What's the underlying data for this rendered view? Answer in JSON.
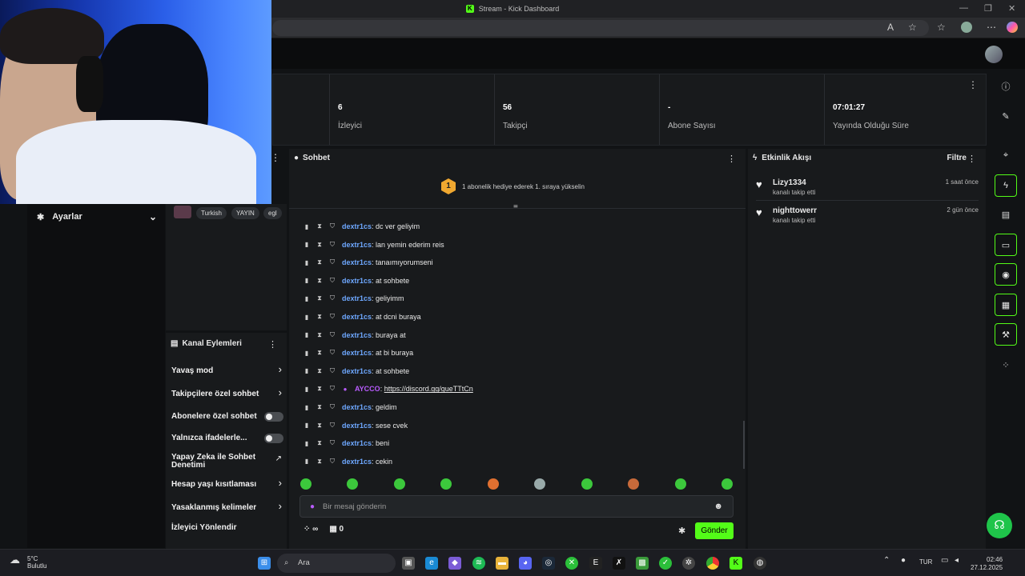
{
  "window": {
    "title": "Stream - Kick Dashboard"
  },
  "stats": [
    {
      "value": "6",
      "label": "İzleyici"
    },
    {
      "value": "56",
      "label": "Takipçi"
    },
    {
      "value": "-",
      "label": "Abone Sayısı"
    },
    {
      "value": "07:01:27",
      "label": "Yayında Olduğu Süre"
    }
  ],
  "sidebar": {
    "settings_label": "Ayarlar"
  },
  "stream_info": {
    "tags": [
      "Turkish",
      "YAYIN",
      "egl"
    ]
  },
  "channel_actions": {
    "title": "Kanal Eylemleri",
    "items": [
      {
        "label": "Yavaş mod",
        "kind": "chevron"
      },
      {
        "label": "Takipçilere özel sohbet",
        "kind": "chevron"
      },
      {
        "label": "Abonelere özel sohbet",
        "kind": "toggle"
      },
      {
        "label": "Yalnızca ifadelerle...",
        "kind": "toggle"
      },
      {
        "label": "Yapay Zeka ile Sohbet Denetimi",
        "kind": "external"
      },
      {
        "label": "Hesap yaşı kısıtlaması",
        "kind": "chevron"
      },
      {
        "label": "Yasaklanmış kelimeler",
        "kind": "chevron"
      },
      {
        "label": "İzleyici Yönlendir",
        "kind": "none"
      }
    ]
  },
  "chat": {
    "title": "Sohbet",
    "goal_text": "1 abonelik hediye ederek 1. sıraya yükselin",
    "goal_rank": "1",
    "messages": [
      {
        "user": "dextr1cs",
        "text": "dc ver geliyim",
        "vip": false
      },
      {
        "user": "dextr1cs",
        "text": "lan yemin ederim reis",
        "vip": false
      },
      {
        "user": "dextr1cs",
        "text": "tanaımıyorumseni",
        "vip": false
      },
      {
        "user": "dextr1cs",
        "text": "at sohbete",
        "vip": false
      },
      {
        "user": "dextr1cs",
        "text": "geliyimm",
        "vip": false
      },
      {
        "user": "dextr1cs",
        "text": "at dcni buraya",
        "vip": false
      },
      {
        "user": "dextr1cs",
        "text": "buraya at",
        "vip": false
      },
      {
        "user": "dextr1cs",
        "text": "at bi buraya",
        "vip": false
      },
      {
        "user": "dextr1cs",
        "text": "at sohbete",
        "vip": false
      },
      {
        "user": "AYCCO",
        "text": "https://discord.gg/gueTTtCn",
        "vip": true
      },
      {
        "user": "dextr1cs",
        "text": "geldim",
        "vip": false
      },
      {
        "user": "dextr1cs",
        "text": "sese cvek",
        "vip": false
      },
      {
        "user": "dextr1cs",
        "text": "beni",
        "vip": false
      },
      {
        "user": "dextr1cs",
        "text": "cekin",
        "vip": false
      }
    ],
    "input_placeholder": "Bir mesaj gönderin",
    "points": "∞",
    "store_count": "0",
    "send_label": "Gönder"
  },
  "activity": {
    "title": "Etkinlik Akışı",
    "filter_label": "Filtre",
    "events": [
      {
        "name": "Lizy1334",
        "desc": "kanalı takip etti",
        "time": "1 saat önce"
      },
      {
        "name": "nighttowerr",
        "desc": "kanalı takip etti",
        "time": "2 gün önce"
      }
    ]
  },
  "taskbar": {
    "weather_temp": "5°C",
    "weather_desc": "Bulutlu",
    "search_label": "Ara",
    "lang": "TUR",
    "time": "02:46",
    "date": "27.12.2025"
  },
  "colors": {
    "accent": "#53fc18",
    "username": "#6ea8ff",
    "vip": "#b95cff"
  }
}
